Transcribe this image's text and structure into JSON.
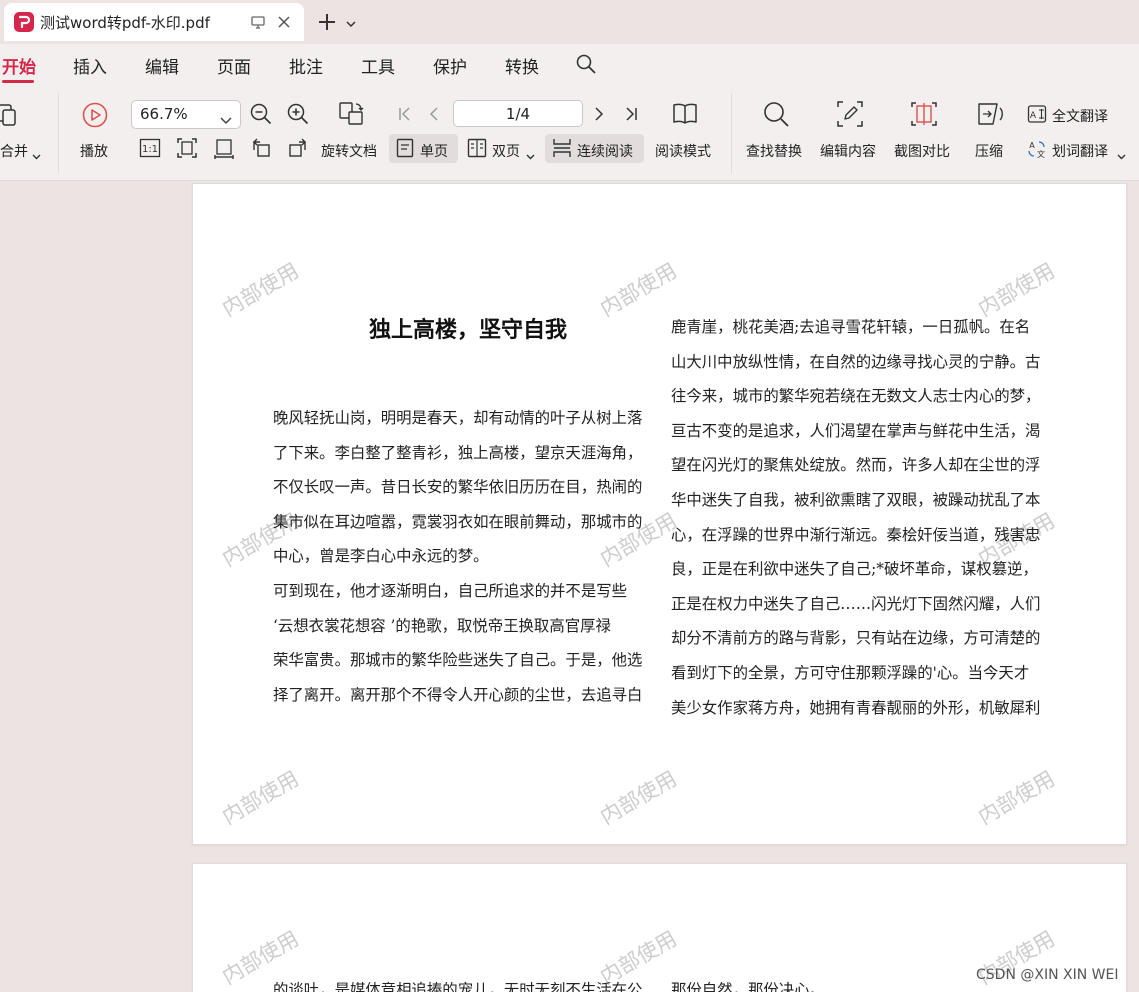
{
  "tab": {
    "title": "测试word转pdf-水印.pdf"
  },
  "menu": {
    "items": [
      "开始",
      "插入",
      "编辑",
      "页面",
      "批注",
      "工具",
      "保护",
      "转换"
    ]
  },
  "toolbar": {
    "merge": "合并",
    "play": "播放",
    "zoom": "66.7%",
    "rotate_doc": "旋转文档",
    "single_page": "单页",
    "double_page": "双页",
    "continuous": "连续阅读",
    "page_indicator": "1/4",
    "read_mode": "阅读模式",
    "find_replace": "查找替换",
    "edit_content": "编辑内容",
    "screenshot_compare": "截图对比",
    "compress": "压缩",
    "full_translate": "全文翻译",
    "word_translate": "划词翻译",
    "actual_size": "1:1"
  },
  "document": {
    "watermark": "内部使用",
    "title": "独上高楼，坚守自我",
    "left_column": [
      "晚风轻抚山岗，明明是春天，却有动情的叶子从树上落",
      "了下来。李白整了整青衫，独上高楼，望京天涯海角，",
      "不仅长叹一声。昔日长安的繁华依旧历历在目，热闹的",
      "集市似在耳边喧嚣，霓裳羽衣如在眼前舞动，那城市的",
      "中心，曾是李白心中永远的梦。",
      "可到现在，他才逐渐明白，自己所追求的并不是写些",
      "‘云想衣裳花想容 ’的艳歌，取悦帝王换取高官厚禄",
      "荣华富贵。那城市的繁华险些迷失了自己。于是，他选",
      "择了离开。离开那个不得令人开心颜的尘世，去追寻白"
    ],
    "right_column": [
      "鹿青崖，桃花美酒;去追寻雪花轩辕，一日孤帆。在名",
      "山大川中放纵性情，在自然的边缘寻找心灵的宁静。古",
      "往今来，城市的繁华宛若绕在无数文人志士内心的梦，",
      "亘古不变的是追求，人们渴望在掌声与鲜花中生活，渴",
      "望在闪光灯的聚焦处绽放。然而，许多人却在尘世的浮",
      "华中迷失了自我，被利欲熏瞎了双眼，被躁动扰乱了本",
      "心，在浮躁的世界中渐行渐远。秦桧奸佞当道，残害忠",
      "良，正是在利欲中迷失了自己;*破坏革命，谋权篡逆，",
      "正是在权力中迷失了自己……闪光灯下固然闪耀，人们",
      "却分不清前方的路与背影，只有站在边缘，方可清楚的",
      "看到灯下的全景，方可守住那颗浮躁的'心。当今天才",
      "美少女作家蒋方舟，她拥有青春靓丽的外形，机敏犀利"
    ],
    "page2_left": "的谈吐，是媒体竞相追捧的宠儿，无时无刻不生活在公",
    "page2_right": "那份自然，那份决心。"
  },
  "credit": "CSDN @XIN XIN WEI"
}
